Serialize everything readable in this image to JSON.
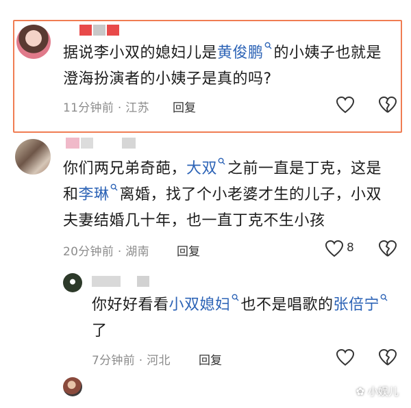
{
  "comments": [
    {
      "parts": [
        "据说李小双的媳妇儿是",
        "黄俊鹏",
        "的小姨子也就是"
      ],
      "line2": "澄海扮演者的小姨子是真的吗?",
      "time": "11分钟前",
      "location": "江苏",
      "reply": "回复"
    },
    {
      "line1a": "你们两兄弟奇葩，",
      "line1b": "大双",
      "line1c": "之前一直是丁克，这是",
      "line2a": "和",
      "line2b": "李琳",
      "line2c": "离婚，找了个小老婆才生的儿子，小双",
      "line3": "夫妻结婚几十年，也一直丁克不生小孩",
      "time": "20分钟前",
      "location": "湖南",
      "reply": "回复",
      "likes": "8"
    },
    {
      "line1a": "你好好看看",
      "line1b": "小双媳妇",
      "line1c": "也不是唱歌的",
      "line1d": "张倍宁",
      "line2": "了",
      "time": "7分钟前",
      "location": "河北",
      "reply": "回复"
    }
  ],
  "separator": "·",
  "cut_off_text": "",
  "watermark": "小娱儿",
  "colors": {
    "highlight": "#f07c52",
    "link": "#2c63b6",
    "meta": "#8c8c8c"
  },
  "icons": [
    "heart-outline-icon",
    "broken-heart-icon",
    "search-icon"
  ]
}
